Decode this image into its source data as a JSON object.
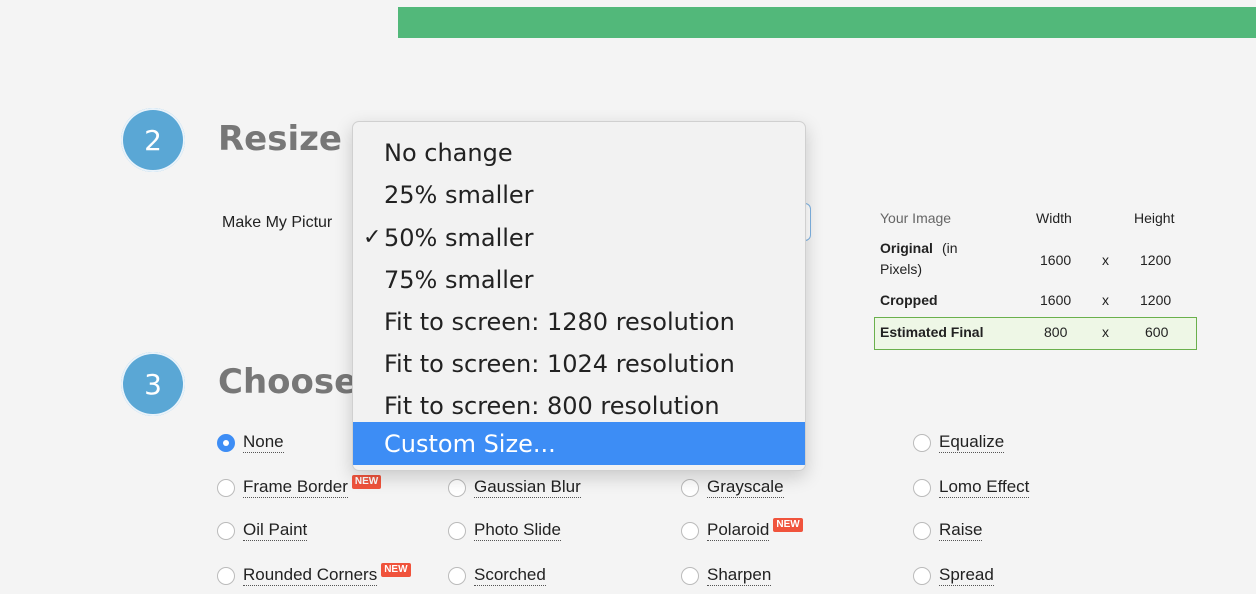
{
  "steps": {
    "resize": {
      "number": "2",
      "title": "Resize Y"
    },
    "choose": {
      "number": "3",
      "title": "Choose"
    }
  },
  "resize": {
    "make_label": "Make My Pictur"
  },
  "dropdown": {
    "items": [
      {
        "label": "No change",
        "checked": false
      },
      {
        "label": "25% smaller",
        "checked": false
      },
      {
        "label": "50% smaller",
        "checked": true
      },
      {
        "label": "75% smaller",
        "checked": false
      },
      {
        "label": "Fit to screen: 1280 resolution",
        "checked": false
      },
      {
        "label": "Fit to screen: 1024 resolution",
        "checked": false
      },
      {
        "label": "Fit to screen: 800 resolution",
        "checked": false
      },
      {
        "label": "Custom Size...",
        "checked": false,
        "highlighted": true
      }
    ],
    "checkmark": "✓"
  },
  "image_info": {
    "headers": {
      "col1": "Your Image",
      "col2": "Width",
      "col3": "Height"
    },
    "rows": [
      {
        "label_bold": "Original",
        "label_rest": " (in",
        "label_line2": "Pixels)",
        "width": "1600",
        "sep": "x",
        "height": "1200"
      },
      {
        "label_bold": "Cropped",
        "width": "1600",
        "sep": "x",
        "height": "1200"
      },
      {
        "label_bold": "Estimated Final",
        "width": "800",
        "sep": "x",
        "height": "600"
      }
    ]
  },
  "effects": {
    "new_badge": "NEW",
    "options": [
      {
        "label": "None",
        "checked": true,
        "new": false
      },
      {
        "label": "Equalize",
        "checked": false,
        "new": false
      },
      {
        "label": "Frame Border",
        "checked": false,
        "new": true
      },
      {
        "label": "Gaussian Blur",
        "checked": false,
        "new": false
      },
      {
        "label": "Grayscale",
        "checked": false,
        "new": false
      },
      {
        "label": "Lomo Effect",
        "checked": false,
        "new": false
      },
      {
        "label": "Oil Paint",
        "checked": false,
        "new": false
      },
      {
        "label": "Photo Slide",
        "checked": false,
        "new": false
      },
      {
        "label": "Polaroid",
        "checked": false,
        "new": true
      },
      {
        "label": "Raise",
        "checked": false,
        "new": false
      },
      {
        "label": "Rounded Corners",
        "checked": false,
        "new": true
      },
      {
        "label": "Scorched",
        "checked": false,
        "new": false
      },
      {
        "label": "Sharpen",
        "checked": false,
        "new": false
      },
      {
        "label": "Spread",
        "checked": false,
        "new": false
      }
    ]
  },
  "colors": {
    "top_bar": "#52b87a",
    "step_badge": "#5aa7d5",
    "highlight": "#3d8df5",
    "new_badge": "#f0533c",
    "final_box_border": "#6ab04c"
  }
}
